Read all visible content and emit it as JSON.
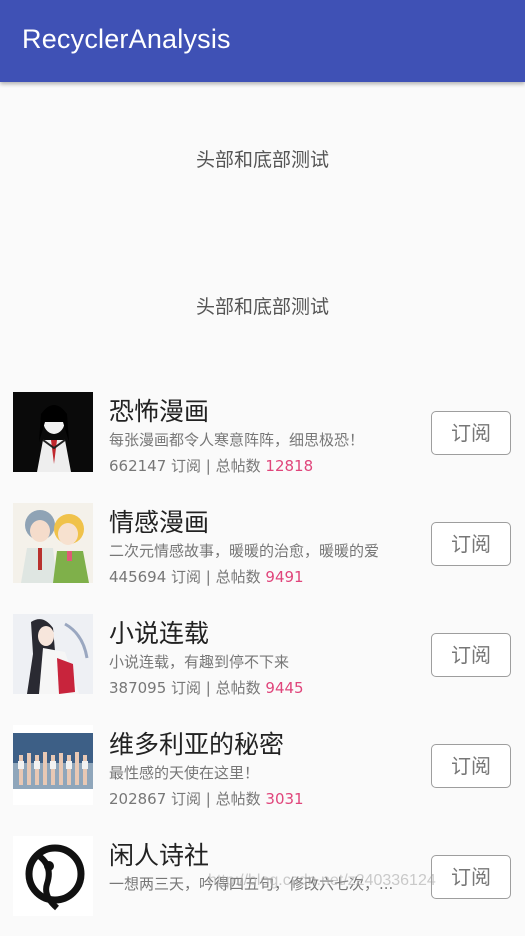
{
  "app": {
    "title": "RecyclerAnalysis",
    "accent": "#3f51b5"
  },
  "headers": [
    "头部和底部测试",
    "头部和底部测试"
  ],
  "subscribe_label": "订阅",
  "stats_sep": " 订阅 | 总帖数 ",
  "items": [
    {
      "title": "恐怖漫画",
      "desc": "每张漫画都令人寒意阵阵，细思极恐！",
      "subscribers": "662147",
      "posts": "12818",
      "image": "horror-comic-thumbnail"
    },
    {
      "title": "情感漫画",
      "desc": "二次元情感故事，暖暖的治愈，暖暖的爱",
      "subscribers": "445694",
      "posts": "9491",
      "image": "romance-comic-thumbnail"
    },
    {
      "title": "小说连载",
      "desc": "小说连载，有趣到停不下来",
      "subscribers": "387095",
      "posts": "9445",
      "image": "novel-serial-thumbnail"
    },
    {
      "title": "维多利亚的秘密",
      "desc": "最性感的天使在这里！",
      "subscribers": "202867",
      "posts": "3031",
      "image": "fashion-show-thumbnail"
    },
    {
      "title": "闲人诗社",
      "desc": "一想两三天，吟得四五句，修改六七次，...",
      "subscribers": "",
      "posts": "",
      "image": "poetry-club-thumbnail"
    }
  ],
  "watermark": "http://blog.csdn.net/z240336124",
  "colors": {
    "posts_count": "#e0457b"
  }
}
